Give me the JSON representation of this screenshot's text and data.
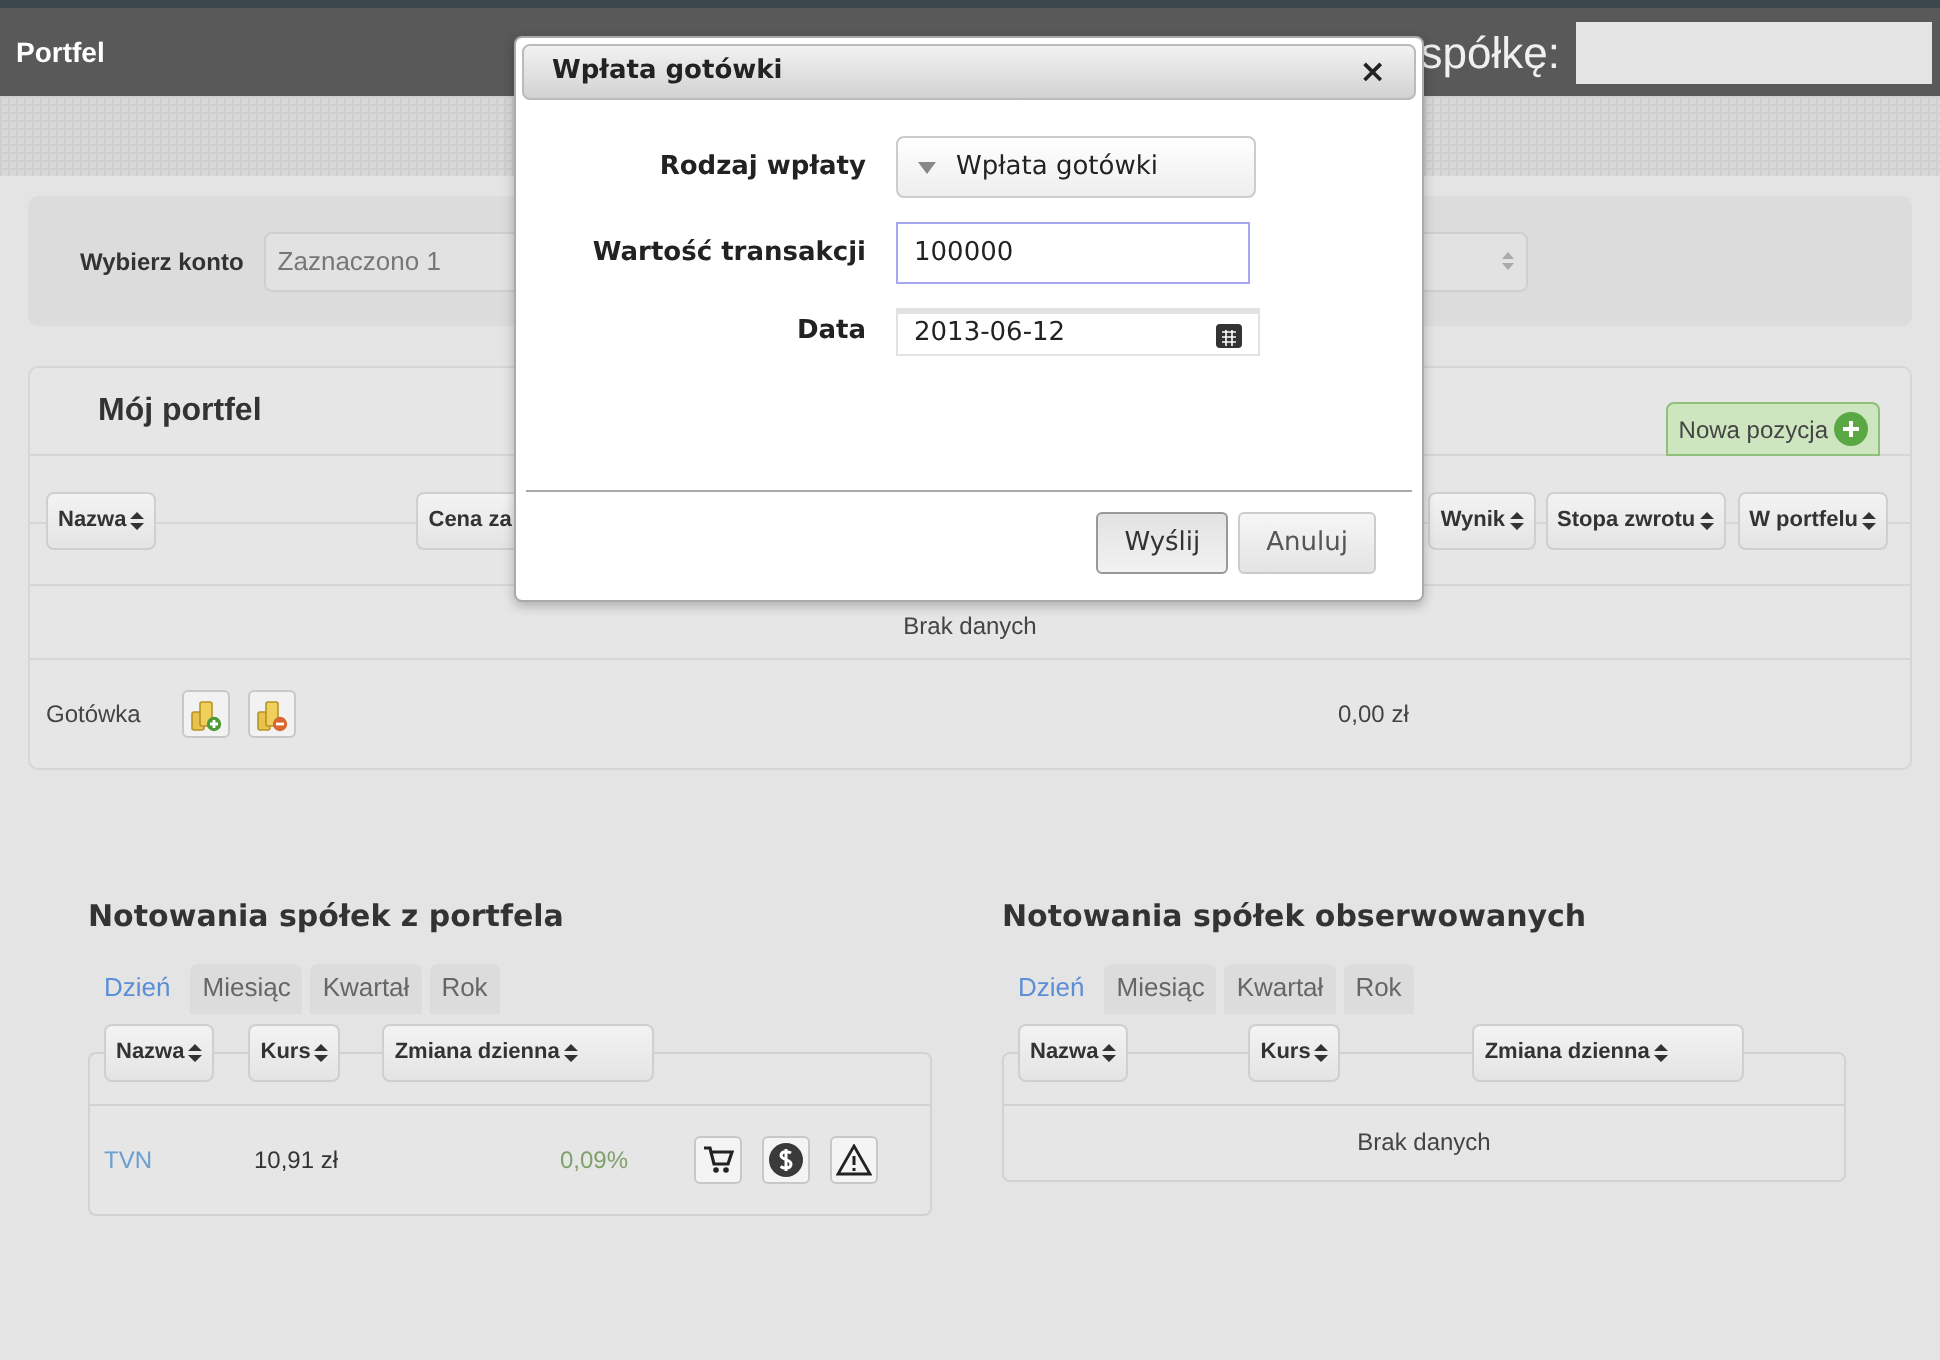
{
  "header": {
    "title": "Portfel",
    "search_label": "spółkę:"
  },
  "account": {
    "label": "Wybierz konto",
    "value": "Zaznaczono 1"
  },
  "portfolio": {
    "title": "Mój portfel",
    "add_button": "Nowa pozycja",
    "columns": [
      "Nazwa",
      "Cena za",
      "Wynik",
      "Stopa zwrotu",
      "W portfelu"
    ],
    "empty_text": "Brak danych",
    "cash": {
      "name": "Gotówka",
      "value": "0,00 zł"
    }
  },
  "quotes": [
    {
      "title": "Notowania spółek z portfela",
      "tabs": [
        {
          "label": "Dzień",
          "selected": true
        },
        {
          "label": "Miesiąc",
          "selected": false
        },
        {
          "label": "Kwartał",
          "selected": false
        },
        {
          "label": "Rok",
          "selected": false
        }
      ],
      "columns": [
        "Nazwa",
        "Kurs",
        "Zmiana dzienna"
      ],
      "rows": [
        {
          "name": "TVN",
          "price": "10,91 zł",
          "change": "0,09%"
        }
      ]
    },
    {
      "title": "Notowania spółek obserwowanych",
      "tabs": [
        {
          "label": "Dzień",
          "selected": true
        },
        {
          "label": "Miesiąc",
          "selected": false
        },
        {
          "label": "Kwartał",
          "selected": false
        },
        {
          "label": "Rok",
          "selected": false
        }
      ],
      "columns": [
        "Nazwa",
        "Kurs",
        "Zmiana dzienna"
      ],
      "empty_text": "Brak danych"
    }
  ],
  "dialog": {
    "title": "Wpłata gotówki",
    "close": "×",
    "fields": [
      {
        "kind": "select",
        "label": "Rodzaj wpłaty",
        "value": "Wpłata gotówki",
        "focused": false
      },
      {
        "kind": "text",
        "label": "Wartość transakcji",
        "value": "100000",
        "focused": true
      },
      {
        "kind": "date",
        "label": "Data",
        "value": "2013-06-12",
        "focused": false
      }
    ],
    "buttons": [
      {
        "label": "Wyślij",
        "pressed": true
      },
      {
        "label": "Anuluj",
        "pressed": false
      }
    ]
  }
}
